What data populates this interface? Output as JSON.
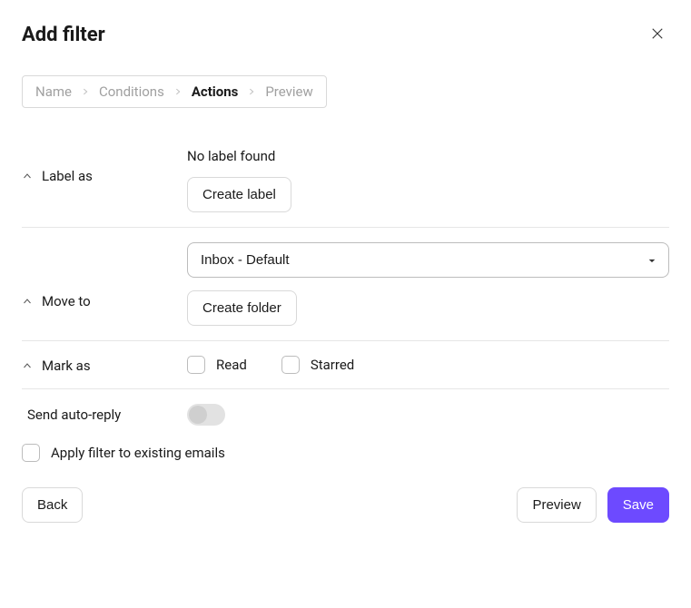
{
  "header": {
    "title": "Add filter"
  },
  "breadcrumb": {
    "items": [
      {
        "label": "Name",
        "active": false
      },
      {
        "label": "Conditions",
        "active": false
      },
      {
        "label": "Actions",
        "active": true
      },
      {
        "label": "Preview",
        "active": false
      }
    ]
  },
  "sections": {
    "label_as": {
      "title": "Label as",
      "no_label_text": "No label found",
      "create_label_btn": "Create label"
    },
    "move_to": {
      "title": "Move to",
      "selected": "Inbox - Default",
      "create_folder_btn": "Create folder"
    },
    "mark_as": {
      "title": "Mark as",
      "read_label": "Read",
      "starred_label": "Starred",
      "read_checked": false,
      "starred_checked": false
    },
    "auto_reply": {
      "title": "Send auto-reply",
      "enabled": false
    }
  },
  "apply_existing": {
    "label": "Apply filter to existing emails",
    "checked": false
  },
  "footer": {
    "back": "Back",
    "preview": "Preview",
    "save": "Save"
  }
}
